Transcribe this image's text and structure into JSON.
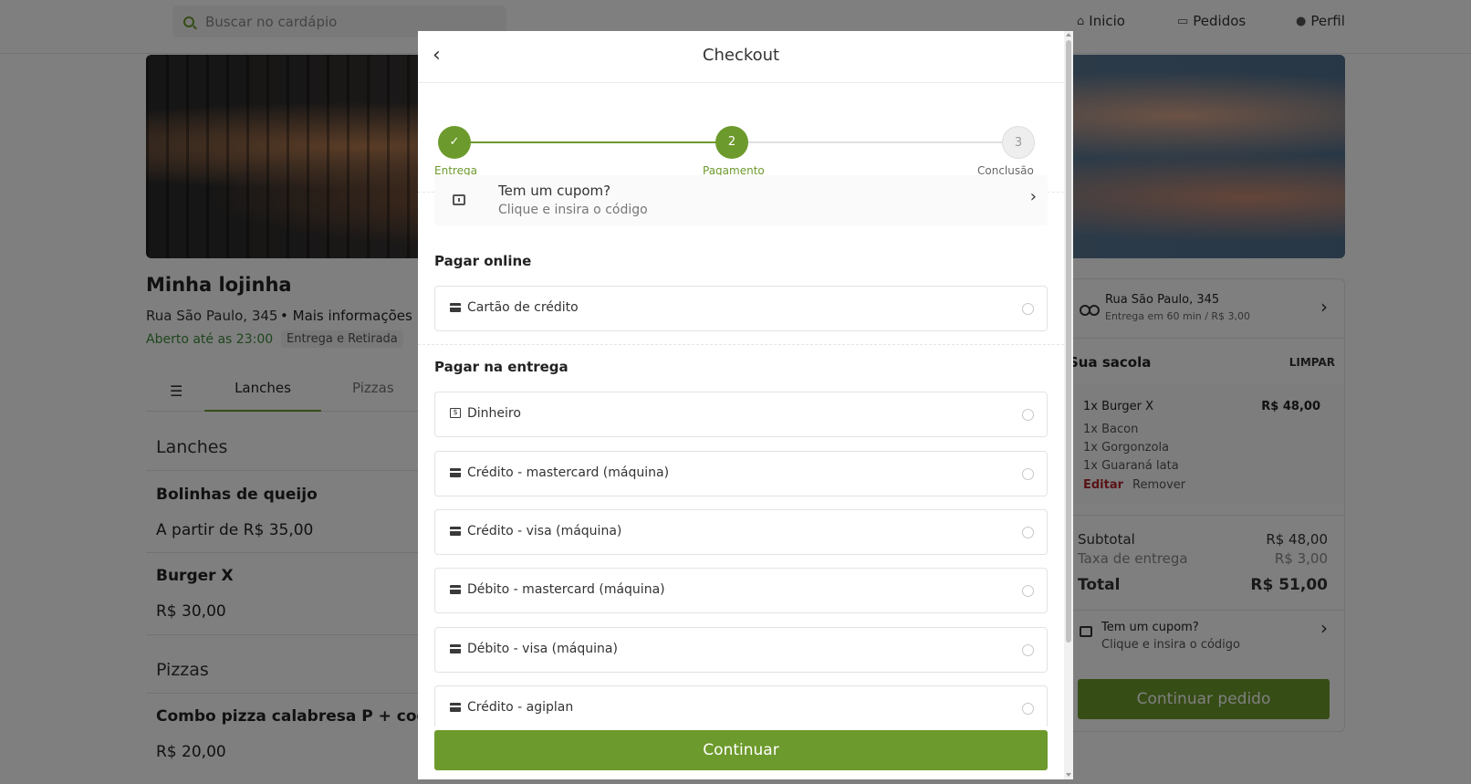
{
  "topbar": {
    "search_placeholder": "Buscar no cardápio",
    "nav": [
      {
        "label": "Inicio",
        "icon": "home-icon"
      },
      {
        "label": "Pedidos",
        "icon": "orders-icon"
      },
      {
        "label": "Perfil",
        "icon": "user-icon"
      }
    ]
  },
  "store": {
    "name": "Minha lojinha",
    "address": "Rua São Paulo, 345",
    "more_info": "Mais informações",
    "open_until": "Aberto até as 23:00",
    "mode": "Entrega e Retirada"
  },
  "menu_tabs": [
    "Lanches",
    "Pizzas"
  ],
  "menu": {
    "sections": [
      {
        "title": "Lanches",
        "products": [
          {
            "name": "Bolinhas de queijo",
            "price": "A partir de R$ 35,00"
          },
          {
            "name": "Burger X",
            "price": "R$ 30,00"
          }
        ]
      },
      {
        "title": "Pizzas",
        "products": [
          {
            "name": "Combo pizza calabresa P + coca-c",
            "price": "R$ 20,00"
          }
        ]
      }
    ]
  },
  "cart": {
    "address": "Rua São Paulo, 345",
    "delivery_info": "Entrega em 60 min / R$ 3,00",
    "bag_title": "Sua sacola",
    "clear": "LIMPAR",
    "item": {
      "name": "1x Burger X",
      "price": "R$ 48,00",
      "extras": [
        "1x Bacon",
        "1x Gorgonzola",
        "1x Guaraná lata"
      ],
      "edit": "Editar",
      "remove": "Remover"
    },
    "subtotal_label": "Subtotal",
    "subtotal": "R$ 48,00",
    "fee_label": "Taxa de entrega",
    "fee": "R$ 3,00",
    "total_label": "Total",
    "total": "R$ 51,00",
    "coupon_title": "Tem um cupom?",
    "coupon_sub": "Clique e insira o código",
    "continue": "Continuar pedido"
  },
  "modal": {
    "title": "Checkout",
    "steps": [
      {
        "label": "Entrega",
        "number": "✓",
        "state": "done"
      },
      {
        "label": "Pagamento",
        "number": "2",
        "state": "active"
      },
      {
        "label": "Conclusão",
        "number": "3",
        "state": "todo"
      }
    ],
    "coupon_title": "Tem um cupom?",
    "coupon_sub": "Clique e insira o código",
    "online_title": "Pagar online",
    "online_options": [
      {
        "label": "Cartão de crédito",
        "icon": "credit-card-icon"
      }
    ],
    "delivery_title": "Pagar na entrega",
    "delivery_options": [
      {
        "label": "Dinheiro",
        "icon": "cash-icon"
      },
      {
        "label": "Crédito - mastercard (máquina)",
        "icon": "credit-card-icon"
      },
      {
        "label": "Crédito - visa (máquina)",
        "icon": "credit-card-icon"
      },
      {
        "label": "Débito - mastercard (máquina)",
        "icon": "credit-card-icon"
      },
      {
        "label": "Débito - visa (máquina)",
        "icon": "credit-card-icon"
      },
      {
        "label": "Crédito - agiplan",
        "icon": "credit-card-icon"
      }
    ],
    "continue": "Continuar"
  },
  "colors": {
    "accent": "#6d9a2c",
    "danger": "#b3262d",
    "open_green": "#3c8a3c"
  }
}
